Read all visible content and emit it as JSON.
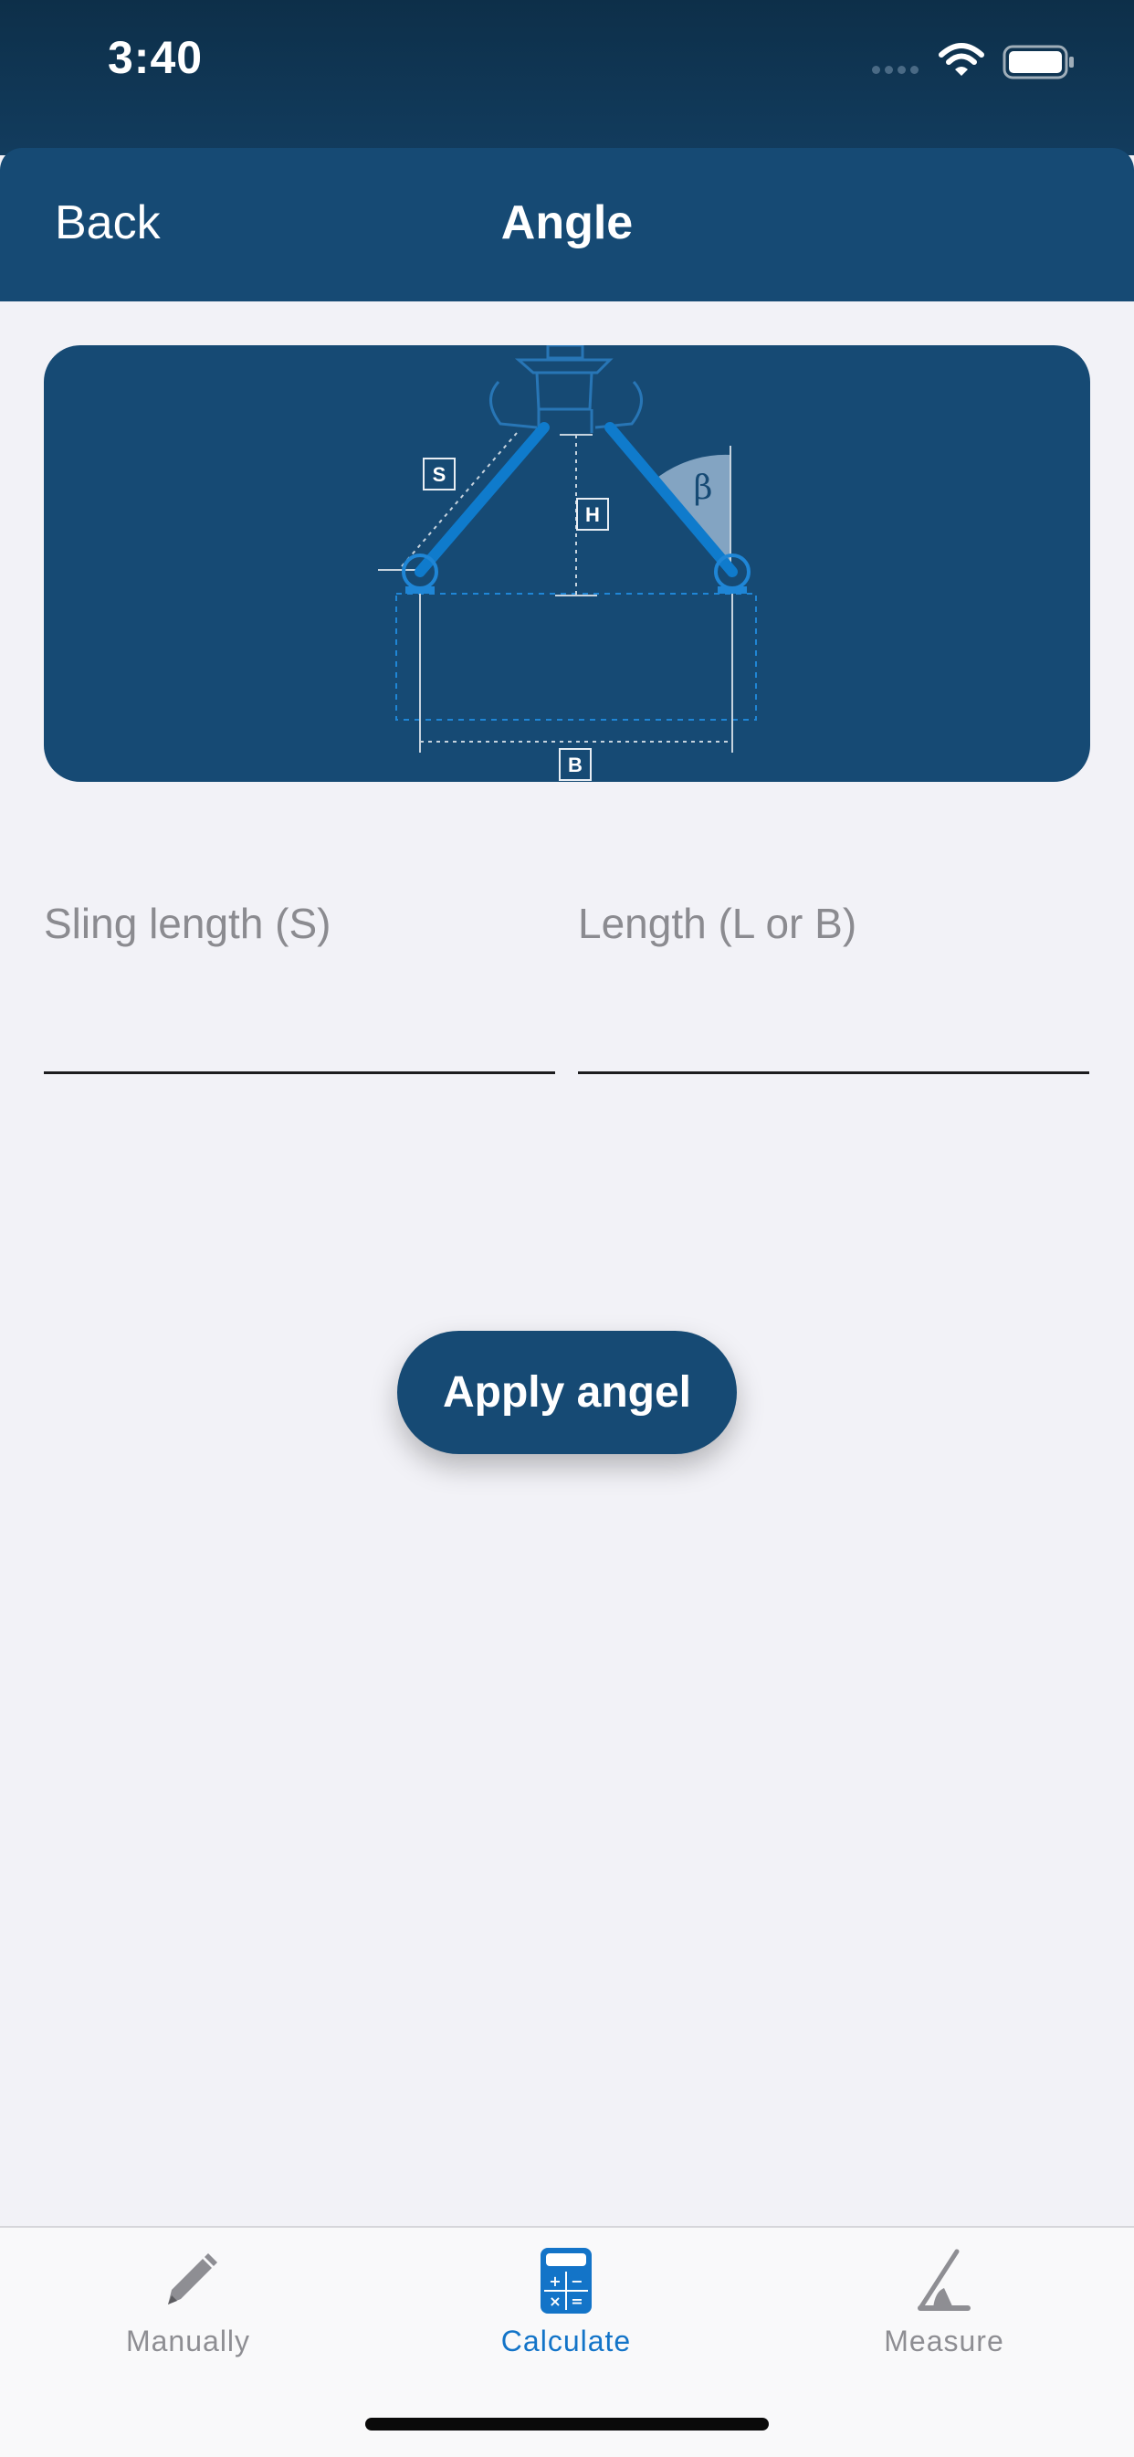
{
  "status_bar": {
    "time": "3:40"
  },
  "nav": {
    "back_label": "Back",
    "title": "Angle"
  },
  "diagram": {
    "label_s": "S",
    "label_h": "H",
    "label_b": "B",
    "angle_symbol": "β"
  },
  "form": {
    "sling_length_label": "Sling length (S)",
    "sling_length_value": "",
    "length_label": "Length (L or B)",
    "length_value": ""
  },
  "apply_button": {
    "label": "Apply angel"
  },
  "tabs": [
    {
      "label": "Manually",
      "icon": "pencil-icon",
      "active": false
    },
    {
      "label": "Calculate",
      "icon": "calculator-icon",
      "active": true
    },
    {
      "label": "Measure",
      "icon": "angle-measure-icon",
      "active": false
    }
  ],
  "colors": {
    "header": "#164a74",
    "background": "#f2f2f7",
    "accent": "#1374c8",
    "inactive_tab": "#8e8e93"
  }
}
